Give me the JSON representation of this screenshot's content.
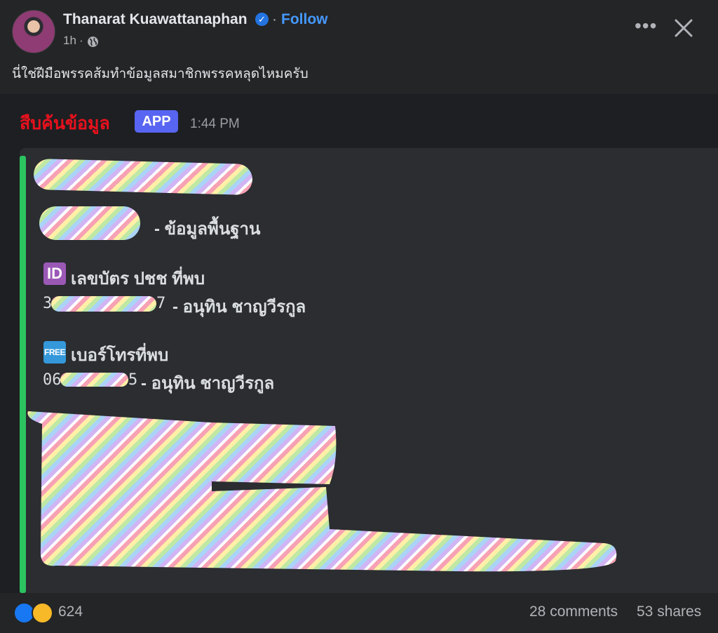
{
  "post": {
    "author": "Thanarat Kuawattanaphan",
    "separator": "·",
    "follow_label": "Follow",
    "time": "1h",
    "privacy_icon": "globe-icon",
    "caption": "นี่ใช่ฝีมือพรรคส้มทำข้อมูลสมาชิกพรรคหลุดไหมครับ"
  },
  "screenshot": {
    "sender": "สืบค้นข้อมูล",
    "app_badge": "APP",
    "timestamp": "1:44 PM",
    "basic_info_label": "- ข้อมูลพื้นฐาน",
    "id_icon_text": "ID",
    "id_heading": "เลขบัตร ปชช ที่พบ",
    "id_prefix": "3",
    "id_suffix": "7",
    "id_owner": "- อนุทิน ชาญวีรกูล",
    "free_icon_text": "FREE",
    "phone_heading": "เบอร์โทรที่พบ",
    "phone_prefix": "06",
    "phone_suffix": "5",
    "phone_owner": "- อนุทิน ชาญวีรกูล"
  },
  "footer": {
    "reaction_count": "624",
    "comments": "28 comments",
    "shares": "53 shares"
  },
  "colors": {
    "link_blue": "#4599ff",
    "sender_red": "#e7111d",
    "app_badge": "#5865f2",
    "embed_bar": "#2cc361"
  }
}
